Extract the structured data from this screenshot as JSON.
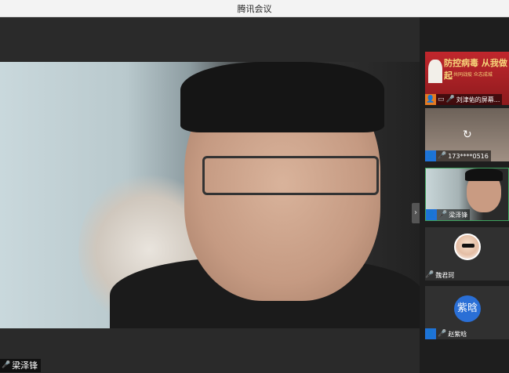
{
  "window": {
    "title": "腾讯会议"
  },
  "main": {
    "active_speaker": "梁泽锋",
    "collapse_icon": "chevron-right-icon"
  },
  "sidebar": {
    "tiles": [
      {
        "name": "刘津佑的屏幕...",
        "banner": "防控病毒 从我做起",
        "banner_sub": "共同战疫 众志成城",
        "badge": "orange"
      },
      {
        "name": "173****0516",
        "badge": "blue"
      },
      {
        "name": "梁泽锋",
        "badge": "blue"
      },
      {
        "name": "魏君珂",
        "badge": "none"
      },
      {
        "name": "赵紫晗",
        "avatar_text": "紫晗",
        "badge": "blue"
      }
    ]
  },
  "colors": {
    "blue_badge": "#1f73d8",
    "orange_badge": "#e57b22",
    "active_border": "#3fa35f"
  }
}
